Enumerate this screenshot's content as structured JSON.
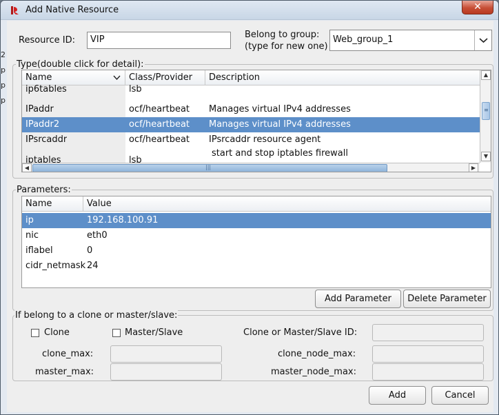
{
  "window": {
    "title": "Add Native Resource",
    "close_glyph": "✕"
  },
  "left_margin_chars": [
    "2",
    "p",
    "p",
    "p"
  ],
  "form": {
    "resource_id_label": "Resource ID:",
    "resource_id_value": "VIP",
    "group_label_line1": "Belong to group:",
    "group_label_line2": "(type for new one)",
    "group_value": "Web_group_1"
  },
  "type_section": {
    "legend": "Type(double click for detail):",
    "columns": [
      "Name",
      "Class/Provider",
      "Description"
    ],
    "rows": [
      {
        "name": "ip6tables",
        "provider": "lsb",
        "description": ""
      },
      {
        "name": "IPaddr",
        "provider": "ocf/heartbeat",
        "description": "Manages virtual IPv4 addresses"
      },
      {
        "name": "IPaddr2",
        "provider": "ocf/heartbeat",
        "description": "Manages virtual IPv4 addresses"
      },
      {
        "name": "IPsrcaddr",
        "provider": "ocf/heartbeat",
        "description": "IPsrcaddr resource agent"
      },
      {
        "name": "iptables",
        "provider": "lsb",
        "description": "start and stop iptables firewall"
      }
    ],
    "selected_row": 2
  },
  "parameters_section": {
    "legend": "Parameters:",
    "columns": [
      "Name",
      "Value"
    ],
    "rows": [
      {
        "name": "ip",
        "value": "192.168.100.91"
      },
      {
        "name": "nic",
        "value": "eth0"
      },
      {
        "name": "iflabel",
        "value": "0"
      },
      {
        "name": "cidr_netmask",
        "value": "24"
      }
    ],
    "selected_row": 0,
    "add_button": "Add Parameter",
    "delete_button": "Delete Parameter"
  },
  "clone_section": {
    "legend": "If belong to a clone or master/slave:",
    "clone_checkbox_label": "Clone",
    "master_slave_checkbox_label": "Master/Slave",
    "clone_id_label": "Clone or Master/Slave ID:",
    "clone_max_label": "clone_max:",
    "clone_node_max_label": "clone_node_max:",
    "master_max_label": "master_max:",
    "master_node_max_label": "master_node_max:"
  },
  "footer": {
    "add_button": "Add",
    "cancel_button": "Cancel"
  },
  "colors": {
    "selection": "#5d8fc9",
    "close_button": "#c74f36",
    "title_bar": "#c8d6e6"
  },
  "icons": {
    "title_icon": "heartbeat-app-icon",
    "combo_arrow": "chevron-down-icon",
    "sort_arrow": "chevron-down-icon"
  }
}
